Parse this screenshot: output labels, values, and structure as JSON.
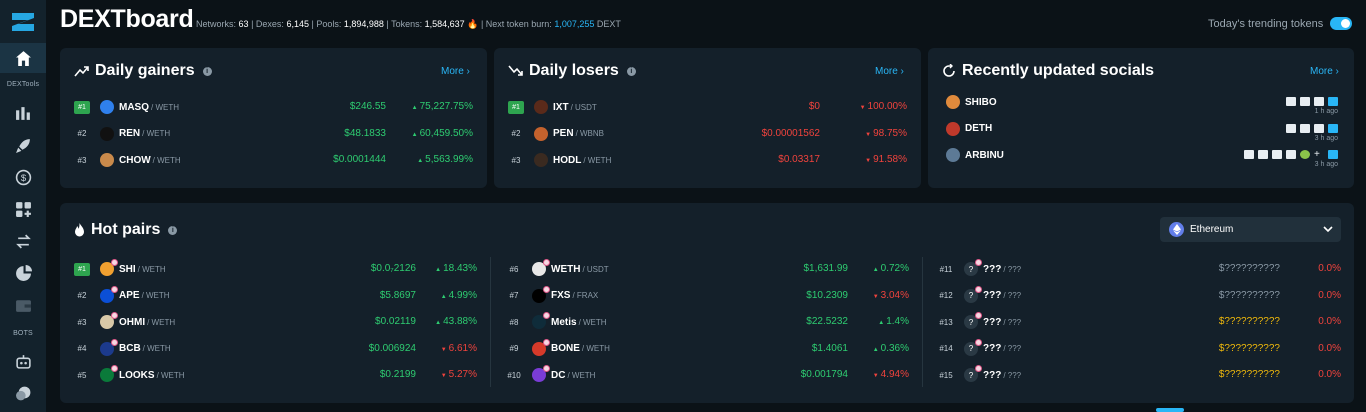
{
  "app": {
    "brand": "DEXTboard",
    "sidebar_caption_1": "DEXTools",
    "sidebar_caption_2": "BOTS"
  },
  "stats": {
    "networks_label": "Networks:",
    "networks_value": "63",
    "dexes_label": "| Dexes:",
    "dexes_value": "6,145",
    "pools_label": "| Pools:",
    "pools_value": "1,894,988",
    "tokens_label": "| Tokens:",
    "tokens_value": "1,584,637",
    "burn_label": "| Next token burn:",
    "burn_value": "1,007,255",
    "burn_unit": "DEXT"
  },
  "trending": {
    "label": "Today's trending tokens",
    "enabled": true
  },
  "gainers": {
    "title": "Daily gainers",
    "more": "More ›",
    "rows": [
      {
        "rank": "#1",
        "symbol": "MASQ",
        "pair": "/ WETH",
        "price": "$246.55",
        "change": "75,227.75%",
        "color": "#2f80ed"
      },
      {
        "rank": "#2",
        "symbol": "REN",
        "pair": "/ WETH",
        "price": "$48.1833",
        "change": "60,459.50%",
        "color": "#111111"
      },
      {
        "rank": "#3",
        "symbol": "CHOW",
        "pair": "/ WETH",
        "price": "$0.0001444",
        "change": "5,563.99%",
        "color": "#c98a4b"
      }
    ]
  },
  "losers": {
    "title": "Daily losers",
    "more": "More ›",
    "rows": [
      {
        "rank": "#1",
        "symbol": "IXT",
        "pair": "/ USDT",
        "price": "$0",
        "change": "100.00%",
        "color": "#5a2a1a"
      },
      {
        "rank": "#2",
        "symbol": "PEN",
        "pair": "/ WBNB",
        "price": "$0.00001562",
        "change": "98.75%",
        "color": "#c4622d"
      },
      {
        "rank": "#3",
        "symbol": "HODL",
        "pair": "/ WETH",
        "price": "$0.03317",
        "change": "91.58%",
        "color": "#3a2a20"
      }
    ]
  },
  "socials": {
    "title": "Recently updated socials",
    "more": "More ›",
    "rows": [
      {
        "symbol": "SHIBO",
        "time": "1 h ago",
        "color": "#e08a3c"
      },
      {
        "symbol": "DETH",
        "time": "3 h ago",
        "color": "#c0392b"
      },
      {
        "symbol": "ARBINU",
        "time": "3 h ago",
        "color": "#5d7a96"
      }
    ]
  },
  "hot": {
    "title": "Hot pairs",
    "network": "Ethereum",
    "col1": [
      {
        "rank": "#1",
        "symbol": "SHI",
        "pair": "/ WETH",
        "price": "$0.0₇2126",
        "change": "18.43%",
        "dir": "up",
        "color": "#f0a030"
      },
      {
        "rank": "#2",
        "symbol": "APE",
        "pair": "/ WETH",
        "price": "$5.8697",
        "change": "4.99%",
        "dir": "up",
        "color": "#0b4fd6"
      },
      {
        "rank": "#3",
        "symbol": "OHMI",
        "pair": "/ WETH",
        "price": "$0.02119",
        "change": "43.88%",
        "dir": "up",
        "color": "#d9c9a8"
      },
      {
        "rank": "#4",
        "symbol": "BCB",
        "pair": "/ WETH",
        "price": "$0.006924",
        "change": "6.61%",
        "dir": "down",
        "color": "#1c3a8c"
      },
      {
        "rank": "#5",
        "symbol": "LOOKS",
        "pair": "/ WETH",
        "price": "$0.2199",
        "change": "5.27%",
        "dir": "down",
        "color": "#0a7a3a"
      }
    ],
    "col2": [
      {
        "rank": "#6",
        "symbol": "WETH",
        "pair": "/ USDT",
        "price": "$1,631.99",
        "change": "0.72%",
        "dir": "up",
        "color": "#e8e8e8"
      },
      {
        "rank": "#7",
        "symbol": "FXS",
        "pair": "/ FRAX",
        "price": "$10.2309",
        "change": "3.04%",
        "dir": "down",
        "color": "#000000"
      },
      {
        "rank": "#8",
        "symbol": "Metis",
        "pair": "/ WETH",
        "price": "$22.5232",
        "change": "1.4%",
        "dir": "up",
        "color": "#0f2c3a"
      },
      {
        "rank": "#9",
        "symbol": "BONE",
        "pair": "/ WETH",
        "price": "$1.4061",
        "change": "0.36%",
        "dir": "up",
        "color": "#d63a2a"
      },
      {
        "rank": "#10",
        "symbol": "DC",
        "pair": "/ WETH",
        "price": "$0.001794",
        "change": "4.94%",
        "dir": "down",
        "color": "#7a3cd6"
      }
    ],
    "col3": [
      {
        "rank": "#11",
        "symbol": "???",
        "pair": "/ ???",
        "price": "$??????????",
        "change": "0.0%",
        "price_color": "grey"
      },
      {
        "rank": "#12",
        "symbol": "???",
        "pair": "/ ???",
        "price": "$??????????",
        "change": "0.0%",
        "price_color": "grey"
      },
      {
        "rank": "#13",
        "symbol": "???",
        "pair": "/ ???",
        "price": "$??????????",
        "change": "0.0%",
        "price_color": "gold"
      },
      {
        "rank": "#14",
        "symbol": "???",
        "pair": "/ ???",
        "price": "$??????????",
        "change": "0.0%",
        "price_color": "gold"
      },
      {
        "rank": "#15",
        "symbol": "???",
        "pair": "/ ???",
        "price": "$??????????",
        "change": "0.0%",
        "price_color": "gold"
      }
    ]
  },
  "colors": {
    "accent": "#29b6f6",
    "up": "#2ecc71",
    "down": "#f0433d",
    "gold": "#f0b90b",
    "card": "#14202a",
    "bg": "#0b1217"
  }
}
